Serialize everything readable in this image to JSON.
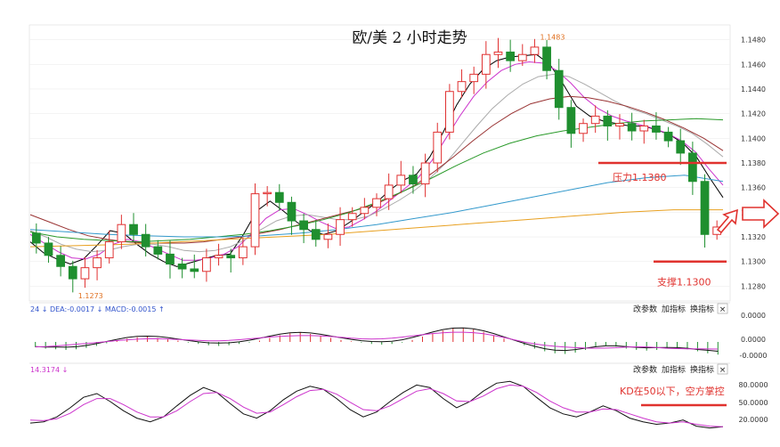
{
  "chart_data": [
    {
      "type": "candlestick",
      "title": "欧/美 2 小时走势",
      "ylim": [
        1.1268,
        1.1492
      ],
      "yticks": [
        "1.1480",
        "1.1460",
        "1.1440",
        "1.1420",
        "1.1400",
        "1.1380",
        "1.1360",
        "1.1340",
        "1.1320",
        "1.1300",
        "1.1280"
      ],
      "high_label": "1.1483",
      "low_label": "1.1273",
      "resistance": {
        "value": 1.138,
        "label": "压力1.1380"
      },
      "support": {
        "value": 1.13,
        "label": "支撑1.1300"
      },
      "close_path": [
        1.1315,
        1.1305,
        1.1296,
        1.1286,
        1.1295,
        1.1303,
        1.1316,
        1.133,
        1.1322,
        1.1312,
        1.1306,
        1.1298,
        1.1294,
        1.1292,
        1.1303,
        1.1305,
        1.1303,
        1.1312,
        1.1355,
        1.1356,
        1.1348,
        1.1333,
        1.1326,
        1.1318,
        1.1322,
        1.1334,
        1.1339,
        1.1344,
        1.1351,
        1.1362,
        1.137,
        1.1363,
        1.138,
        1.1405,
        1.1438,
        1.1446,
        1.1452,
        1.1468,
        1.147,
        1.1463,
        1.1468,
        1.1474,
        1.1455,
        1.1425,
        1.1404,
        1.1412,
        1.1418,
        1.141,
        1.1412,
        1.1406,
        1.141,
        1.1405,
        1.1398,
        1.1388,
        1.1365,
        1.1322,
        1.1328
      ],
      "ma_lines": [
        {
          "color": "#000000",
          "values": [
            1.1316,
            1.1307,
            1.1302,
            1.1298,
            1.1302,
            1.1313,
            1.1325,
            1.1323,
            1.1314,
            1.1306,
            1.13,
            1.1296,
            1.1299,
            1.1302,
            1.1305,
            1.1306,
            1.1322,
            1.1341,
            1.1349,
            1.1341,
            1.1332,
            1.1325,
            1.1322,
            1.1325,
            1.1332,
            1.134,
            1.1348,
            1.1358,
            1.1366,
            1.1371,
            1.1385,
            1.1405,
            1.1427,
            1.1444,
            1.1456,
            1.1463,
            1.1466,
            1.1467,
            1.1468,
            1.146,
            1.1444,
            1.1426,
            1.1418,
            1.1414,
            1.1412,
            1.141,
            1.141,
            1.1407,
            1.1403,
            1.1396,
            1.1385,
            1.1368,
            1.1352
          ]
        },
        {
          "color": "#cc33cc",
          "values": [
            1.1322,
            1.1315,
            1.1308,
            1.1303,
            1.1302,
            1.1306,
            1.1314,
            1.1318,
            1.1316,
            1.1311,
            1.1306,
            1.1301,
            1.1301,
            1.1303,
            1.1306,
            1.1312,
            1.1323,
            1.1335,
            1.1342,
            1.1343,
            1.1338,
            1.1332,
            1.1327,
            1.1328,
            1.1334,
            1.1341,
            1.135,
            1.1359,
            1.1368,
            1.1382,
            1.14,
            1.1418,
            1.1434,
            1.1446,
            1.1455,
            1.146,
            1.1462,
            1.1461,
            1.1455,
            1.1445,
            1.1433,
            1.1424,
            1.1418,
            1.1414,
            1.1411,
            1.1408,
            1.1404,
            1.1398,
            1.1389,
            1.1375,
            1.1362
          ]
        },
        {
          "color": "#aaaaaa",
          "values": [
            1.1325,
            1.132,
            1.1314,
            1.131,
            1.1308,
            1.1309,
            1.1312,
            1.1314,
            1.1314,
            1.1312,
            1.1309,
            1.1308,
            1.1309,
            1.1312,
            1.1318,
            1.1326,
            1.1333,
            1.1337,
            1.1338,
            1.1336,
            1.1334,
            1.1334,
            1.1337,
            1.1343,
            1.135,
            1.1358,
            1.1368,
            1.138,
            1.1395,
            1.141,
            1.1424,
            1.1435,
            1.1444,
            1.145,
            1.1452,
            1.145,
            1.1444,
            1.1437,
            1.143,
            1.1424,
            1.142,
            1.1415,
            1.141,
            1.1404,
            1.1395,
            1.1385
          ]
        },
        {
          "color": "#993333",
          "values": [
            1.1338,
            1.1332,
            1.1326,
            1.1321,
            1.1318,
            1.1316,
            1.1315,
            1.1315,
            1.1315,
            1.1316,
            1.1318,
            1.132,
            1.1323,
            1.1326,
            1.133,
            1.1334,
            1.1338,
            1.1342,
            1.1347,
            1.1354,
            1.1362,
            1.1373,
            1.1385,
            1.1398,
            1.141,
            1.142,
            1.1428,
            1.1432,
            1.1434,
            1.1433,
            1.143,
            1.1426,
            1.1421,
            1.1415,
            1.1408,
            1.14,
            1.139
          ]
        },
        {
          "color": "#2a9a2a",
          "values": [
            1.1324,
            1.132,
            1.1318,
            1.1317,
            1.1316,
            1.1317,
            1.1318,
            1.132,
            1.1322,
            1.1325,
            1.1329,
            1.1334,
            1.134,
            1.1348,
            1.1357,
            1.1367,
            1.1378,
            1.1388,
            1.1396,
            1.1402,
            1.1406,
            1.1409,
            1.1412,
            1.1414,
            1.1415,
            1.1416,
            1.1415
          ]
        },
        {
          "color": "#3399cc",
          "values": [
            1.1326,
            1.1324,
            1.1322,
            1.1321,
            1.132,
            1.132,
            1.1321,
            1.1323,
            1.1326,
            1.133,
            1.1335,
            1.134,
            1.1346,
            1.1352,
            1.1358,
            1.1364,
            1.1368,
            1.137,
            1.1365
          ]
        },
        {
          "color": "#e8a020",
          "values": [
            1.1312,
            1.1313,
            1.1314,
            1.1316,
            1.1318,
            1.132,
            1.1322,
            1.1325,
            1.1328,
            1.1331,
            1.1334,
            1.1337,
            1.134,
            1.1342,
            1.1342
          ]
        }
      ]
    },
    {
      "type": "bar",
      "title": "",
      "indicator_text": "24 ↓ DEA:-0.0017 ↓ MACD:-0.0015 ↑",
      "yticks": [
        "0.0000",
        "0.0000",
        "-0.0000"
      ],
      "values": [
        -0.8,
        -1.0,
        -1.1,
        -1.2,
        -1.1,
        -0.9,
        -0.6,
        -0.2,
        0.2,
        0.5,
        0.7,
        0.8,
        0.6,
        0.4,
        0.2,
        -0.1,
        -0.3,
        -0.5,
        -0.6,
        -0.5,
        -0.3,
        -0.1,
        0.2,
        0.6,
        1.0,
        1.3,
        1.4,
        1.2,
        0.9,
        0.6,
        0.3,
        0.1,
        -0.1,
        -0.3,
        -0.4,
        -0.3,
        -0.1,
        0.3,
        0.8,
        1.3,
        1.7,
        2.0,
        2.1,
        1.9,
        1.5,
        1.0,
        0.5,
        0.0,
        -0.5,
        -1.0,
        -1.4,
        -1.7,
        -1.8,
        -1.6,
        -1.2,
        -0.8,
        -0.6,
        -0.7,
        -1.0,
        -1.2,
        -1.3,
        -1.2,
        -1.0,
        -0.9,
        -1.1,
        -1.4,
        -1.7,
        -1.9
      ]
    },
    {
      "type": "line",
      "title": "",
      "indicator_text": "14.3174 ↓",
      "ylim": [
        10,
        100
      ],
      "yticks": [
        "80.0000",
        "50.0000",
        "20.0000"
      ],
      "annotation": "KD在50以下，空方掌控",
      "series": [
        {
          "color": "#111111",
          "values": [
            20,
            22,
            30,
            45,
            62,
            68,
            55,
            40,
            28,
            22,
            30,
            48,
            65,
            78,
            70,
            52,
            35,
            28,
            40,
            58,
            72,
            80,
            75,
            60,
            42,
            30,
            38,
            55,
            70,
            82,
            78,
            60,
            45,
            55,
            72,
            85,
            88,
            80,
            62,
            45,
            35,
            30,
            38,
            48,
            40,
            28,
            22,
            18,
            20,
            25,
            15,
            12,
            14
          ]
        },
        {
          "color": "#cc33cc",
          "values": [
            25,
            24,
            27,
            36,
            50,
            60,
            60,
            50,
            38,
            30,
            30,
            40,
            55,
            68,
            70,
            60,
            46,
            36,
            38,
            50,
            63,
            73,
            75,
            67,
            54,
            42,
            40,
            48,
            60,
            72,
            76,
            68,
            56,
            55,
            64,
            76,
            82,
            80,
            70,
            56,
            45,
            38,
            38,
            43,
            42,
            35,
            28,
            22,
            20,
            22,
            18,
            15,
            14
          ]
        }
      ]
    }
  ],
  "controls": {
    "change_params": "改参数",
    "add_indicator": "加指标",
    "switch_indicator": "换指标",
    "close": "×"
  }
}
